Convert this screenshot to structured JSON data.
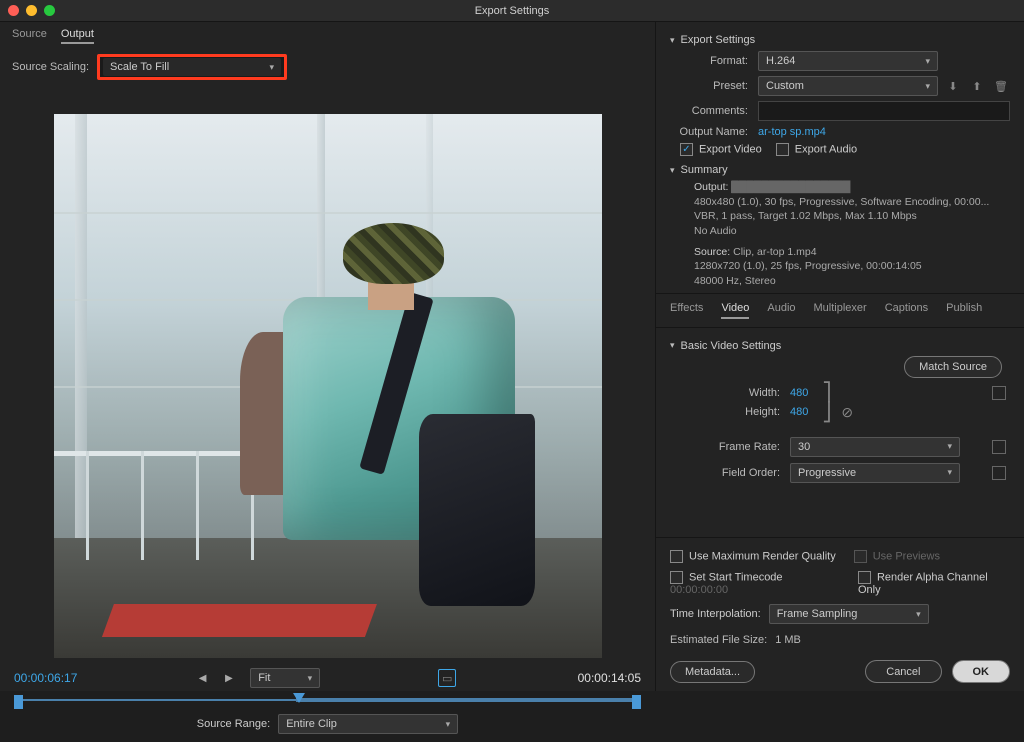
{
  "window": {
    "title": "Export Settings"
  },
  "left": {
    "tabs": {
      "source": "Source",
      "output": "Output"
    },
    "source_scaling_label": "Source Scaling:",
    "source_scaling_value": "Scale To Fill",
    "current_tc": "00:00:06:17",
    "duration_tc": "00:00:14:05",
    "fit_label": "Fit",
    "source_range_label": "Source Range:",
    "source_range_value": "Entire Clip"
  },
  "export": {
    "header": "Export Settings",
    "format_label": "Format:",
    "format_value": "H.264",
    "preset_label": "Preset:",
    "preset_value": "Custom",
    "comments_label": "Comments:",
    "output_name_label": "Output Name:",
    "output_name_value": "ar-top sp.mp4",
    "export_video": "Export Video",
    "export_audio": "Export Audio"
  },
  "summary": {
    "header": "Summary",
    "output_label": "Output:",
    "output_line1": "480x480 (1.0), 30 fps, Progressive, Software Encoding, 00:00...",
    "output_line2": "VBR, 1 pass, Target 1.02 Mbps, Max 1.10 Mbps",
    "output_line3": "No Audio",
    "source_label": "Source:",
    "source_line0": "Clip, ar-top 1.mp4",
    "source_line1": "1280x720 (1.0), 25 fps, Progressive, 00:00:14:05",
    "source_line2": "48000 Hz, Stereo"
  },
  "tabs": {
    "effects": "Effects",
    "video": "Video",
    "audio": "Audio",
    "multiplexer": "Multiplexer",
    "captions": "Captions",
    "publish": "Publish"
  },
  "bvs": {
    "header": "Basic Video Settings",
    "match_source": "Match Source",
    "width_label": "Width:",
    "width_value": "480",
    "height_label": "Height:",
    "height_value": "480",
    "frame_rate_label": "Frame Rate:",
    "frame_rate_value": "30",
    "field_order_label": "Field Order:",
    "field_order_value": "Progressive"
  },
  "bottom": {
    "use_max_quality": "Use Maximum Render Quality",
    "use_previews": "Use Previews",
    "start_tc_label": "Set Start Timecode",
    "start_tc_value": "00:00:00:00",
    "render_alpha": "Render Alpha Channel Only",
    "time_interp_label": "Time Interpolation:",
    "time_interp_value": "Frame Sampling",
    "est_label": "Estimated File Size:",
    "est_value": "1 MB",
    "metadata": "Metadata...",
    "cancel": "Cancel",
    "ok": "OK"
  }
}
